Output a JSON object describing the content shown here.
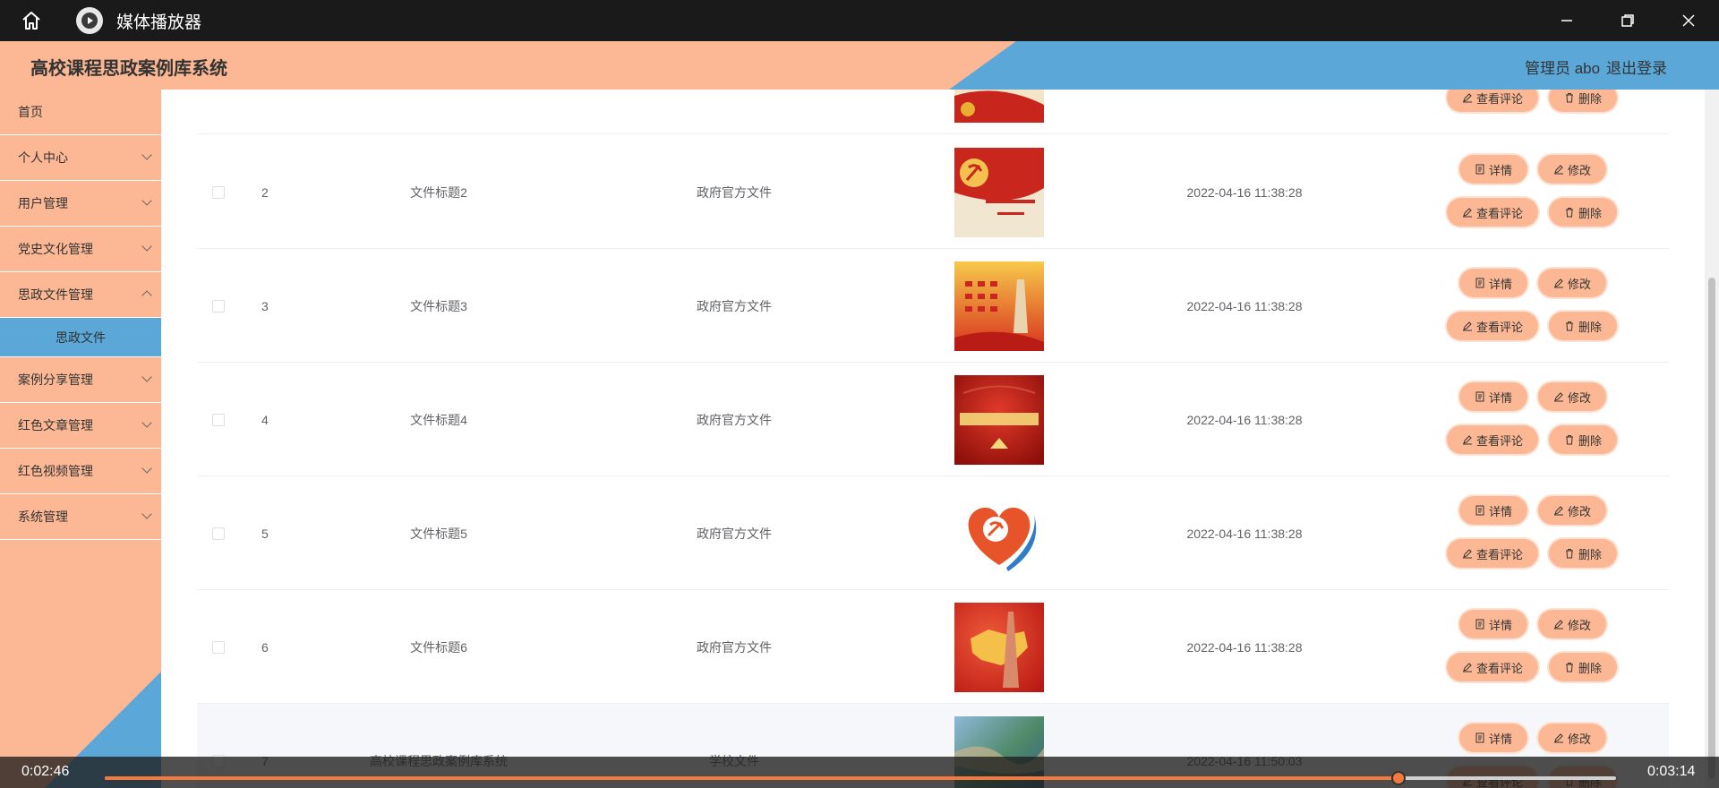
{
  "window": {
    "title": "媒体播放器"
  },
  "header": {
    "app_title": "高校课程思政案例库系统",
    "user": "管理员 abo",
    "logout": "退出登录"
  },
  "sidebar": {
    "items": [
      {
        "label": "首页",
        "expandable": false
      },
      {
        "label": "个人中心",
        "expandable": true
      },
      {
        "label": "用户管理",
        "expandable": true
      },
      {
        "label": "党史文化管理",
        "expandable": true
      },
      {
        "label": "思政文件管理",
        "expandable": true,
        "expanded": true
      },
      {
        "label": "案例分享管理",
        "expandable": true
      },
      {
        "label": "红色文章管理",
        "expandable": true
      },
      {
        "label": "红色视频管理",
        "expandable": true
      },
      {
        "label": "系统管理",
        "expandable": true
      }
    ],
    "active_sub": "思政文件"
  },
  "table": {
    "actions": {
      "detail": "详情",
      "edit": "修改",
      "comment": "查看评论",
      "delete": "删除"
    },
    "rows": [
      {
        "index": "2",
        "title": "文件标题2",
        "type": "政府官方文件",
        "time": "2022-04-16 11:38:28",
        "image": "party-emblem-gold"
      },
      {
        "index": "3",
        "title": "文件标题3",
        "type": "政府官方文件",
        "time": "2022-04-16 11:38:28",
        "image": "red-gold-banner"
      },
      {
        "index": "4",
        "title": "文件标题4",
        "type": "政府官方文件",
        "time": "2022-04-16 11:38:28",
        "image": "red-hall"
      },
      {
        "index": "5",
        "title": "文件标题5",
        "type": "政府官方文件",
        "time": "2022-04-16 11:38:28",
        "image": "heart-emblem"
      },
      {
        "index": "6",
        "title": "文件标题6",
        "type": "政府官方文件",
        "time": "2022-04-16 11:38:28",
        "image": "red-map"
      },
      {
        "index": "7",
        "title": "高校课程思政案例库系统",
        "type": "学校文件",
        "time": "2022-04-16 11:50:03",
        "image": "landscape-photo"
      }
    ]
  },
  "player": {
    "current_time": "0:02:46",
    "duration": "0:03:14",
    "progress": 0.856
  },
  "colors": {
    "peach": "#fcb894",
    "blue": "#5aa7d8",
    "accent": "#f37a3c"
  }
}
